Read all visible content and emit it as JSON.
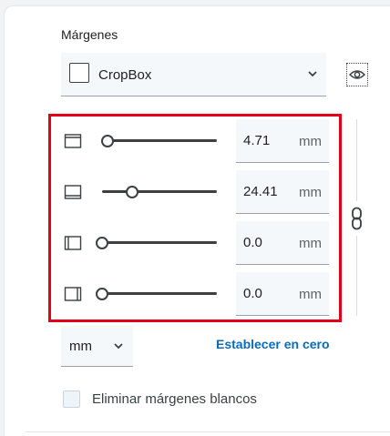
{
  "margins": {
    "title": "Márgenes",
    "box_select": {
      "value": "CropBox"
    },
    "rows": [
      {
        "edge": "top",
        "value": "4.71",
        "unit": "mm",
        "slider_fraction": 0.0
      },
      {
        "edge": "bottom",
        "value": "24.41",
        "unit": "mm",
        "slider_fraction": 0.26
      },
      {
        "edge": "left",
        "value": "0.0",
        "unit": "mm",
        "slider_fraction": 0.0
      },
      {
        "edge": "right",
        "value": "0.0",
        "unit": "mm",
        "slider_fraction": 0.0
      }
    ],
    "unit_select": {
      "value": "mm"
    },
    "reset_label": "Establecer en cero",
    "remove_white_margins": {
      "label": "Eliminar márgenes blancos",
      "checked": false
    }
  },
  "icons": {
    "preview": "eye-icon",
    "link": "link-icon",
    "dropdown": "chevron-down-icon"
  },
  "colors": {
    "highlight": "#e3001b",
    "link": "#0b6bb8",
    "field_bg": "#f5f8fb"
  }
}
